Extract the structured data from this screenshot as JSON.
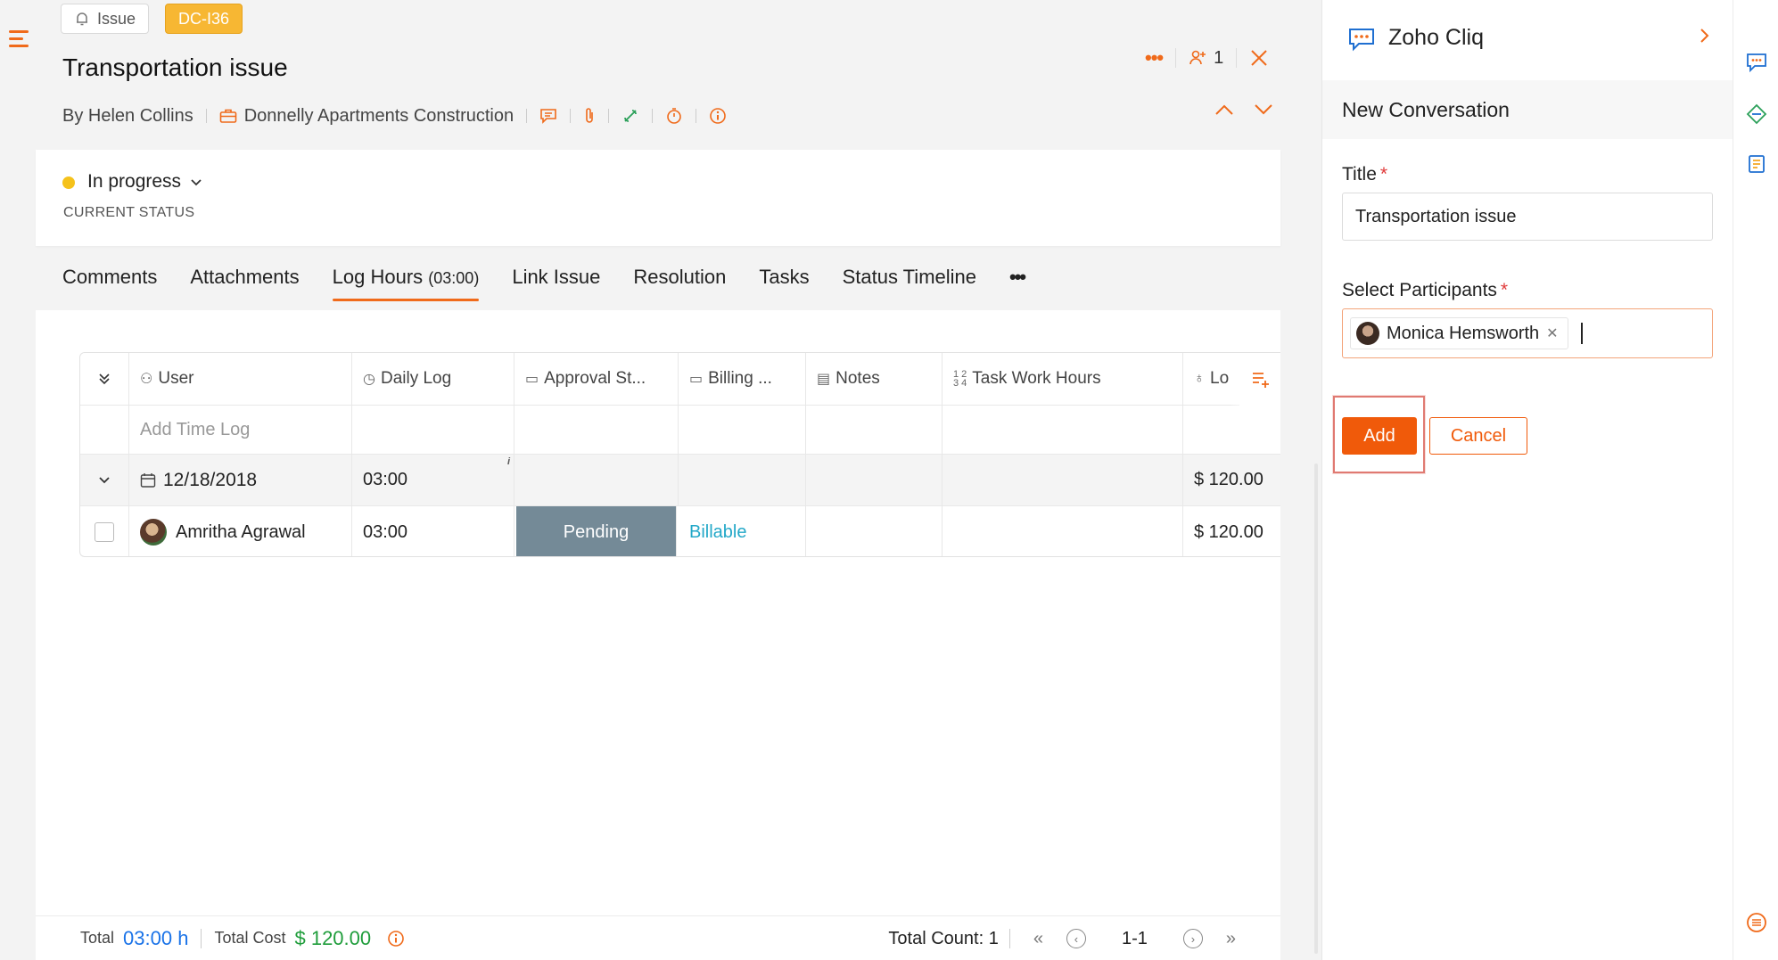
{
  "header": {
    "chip_issue": "Issue",
    "chip_id": "DC-I36",
    "title": "Transportation issue",
    "author": "By Helen Collins",
    "project": "Donnelly Apartments Construction",
    "follower_count": "1"
  },
  "status": {
    "value": "In progress",
    "label": "CURRENT STATUS",
    "color": "#f5c21b"
  },
  "tabs": [
    {
      "label": "Comments"
    },
    {
      "label": "Attachments"
    },
    {
      "label": "Log Hours",
      "extra": "(03:00)"
    },
    {
      "label": "Link Issue"
    },
    {
      "label": "Resolution"
    },
    {
      "label": "Tasks"
    },
    {
      "label": "Status Timeline"
    }
  ],
  "table": {
    "columns": [
      "User",
      "Daily Log",
      "Approval St...",
      "Billing ...",
      "Notes",
      "Task Work Hours",
      "Lo"
    ],
    "add_placeholder": "Add Time Log",
    "group": {
      "date": "12/18/2018",
      "daily_log": "03:00",
      "cost": "$ 120.00"
    },
    "rows": [
      {
        "user": "Amritha Agrawal",
        "daily_log": "03:00",
        "approval": "Pending",
        "billing": "Billable",
        "cost": "$ 120.00"
      }
    ]
  },
  "footer": {
    "total_label": "Total",
    "total_value": "03:00 h",
    "cost_label": "Total Cost",
    "cost_value": "$ 120.00",
    "count_label": "Total Count: 1",
    "page_range": "1-1"
  },
  "cliq": {
    "app_name": "Zoho Cliq",
    "subtitle": "New Conversation",
    "title_label": "Title",
    "title_value": "Transportation issue",
    "participants_label": "Select Participants",
    "participant": "Monica Hemsworth",
    "add_label": "Add",
    "cancel_label": "Cancel"
  },
  "colors": {
    "accent": "#f06a1a",
    "pending": "#748a97",
    "billable": "#23a8c8",
    "total_blue": "#1a73e8",
    "cost_green": "#1f9d3b"
  }
}
